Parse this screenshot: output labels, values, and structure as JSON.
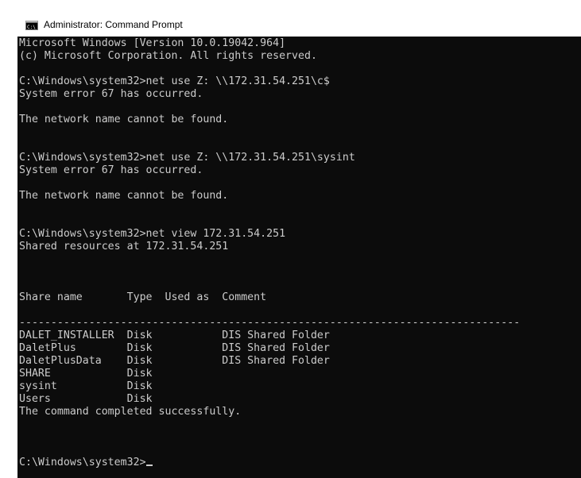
{
  "window": {
    "title": "Administrator: Command Prompt"
  },
  "console": {
    "lines": [
      "Microsoft Windows [Version 10.0.19042.964]",
      "(c) Microsoft Corporation. All rights reserved.",
      "",
      "C:\\Windows\\system32>net use Z: \\\\172.31.54.251\\c$",
      "System error 67 has occurred.",
      "",
      "The network name cannot be found.",
      "",
      "",
      "C:\\Windows\\system32>net use Z: \\\\172.31.54.251\\sysint",
      "System error 67 has occurred.",
      "",
      "The network name cannot be found.",
      "",
      "",
      "C:\\Windows\\system32>net view 172.31.54.251",
      "Shared resources at 172.31.54.251",
      "",
      "",
      "",
      "Share name       Type  Used as  Comment",
      "",
      "-------------------------------------------------------------------------------",
      "DALET_INSTALLER  Disk           DIS Shared Folder",
      "DaletPlus        Disk           DIS Shared Folder",
      "DaletPlusData    Disk           DIS Shared Folder",
      "SHARE            Disk",
      "sysint           Disk",
      "Users            Disk",
      "The command completed successfully.",
      "",
      "",
      ""
    ],
    "prompt": "C:\\Windows\\system32>"
  }
}
